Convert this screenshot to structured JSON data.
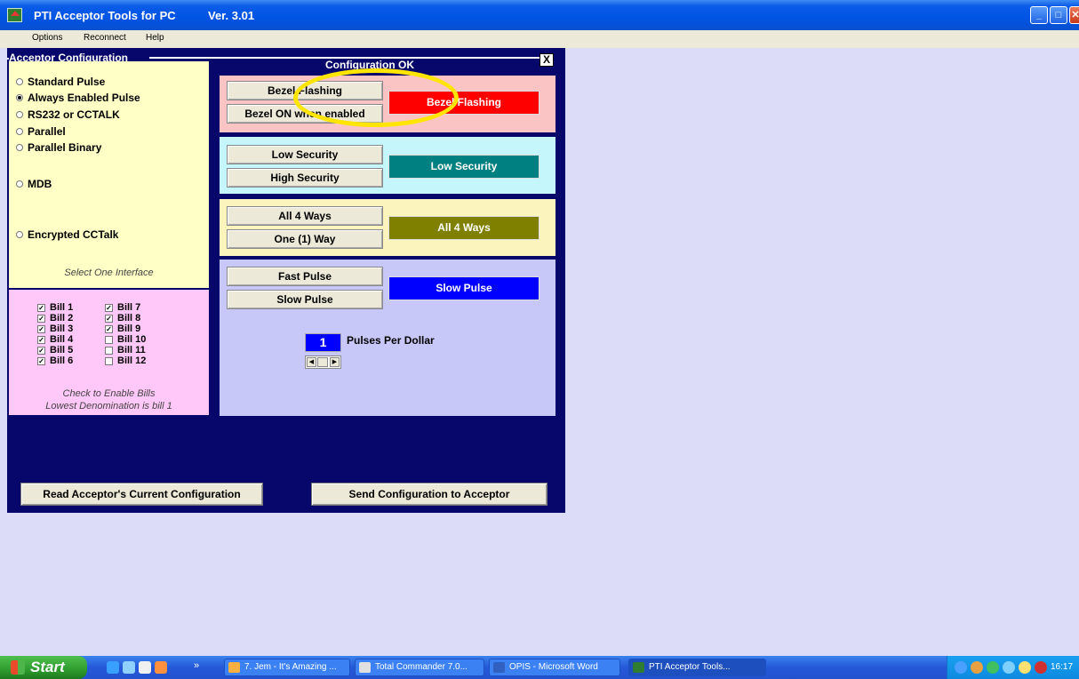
{
  "window": {
    "title": "PTI Acceptor Tools for PC",
    "version": "Ver. 3.01"
  },
  "menu": [
    "Options",
    "Reconnect",
    "Help"
  ],
  "config": {
    "title": "Acceptor Configuration",
    "status": "Configuration OK",
    "close_glyph": "X",
    "interfaces": [
      {
        "label": "Standard Pulse",
        "selected": false
      },
      {
        "label": "Always Enabled Pulse",
        "selected": true
      },
      {
        "label": "RS232 or CCTALK",
        "selected": false
      },
      {
        "label": "Parallel",
        "selected": false
      },
      {
        "label": "Parallel Binary",
        "selected": false
      },
      {
        "label": "MDB",
        "selected": false
      },
      {
        "label": "Encrypted CCTalk",
        "selected": false
      }
    ],
    "interface_hint": "Select One Interface",
    "bills": [
      {
        "label": "Bill 1",
        "checked": true
      },
      {
        "label": "Bill 2",
        "checked": true
      },
      {
        "label": "Bill 3",
        "checked": true
      },
      {
        "label": "Bill 4",
        "checked": true
      },
      {
        "label": "Bill 5",
        "checked": true
      },
      {
        "label": "Bill 6",
        "checked": true
      },
      {
        "label": "Bill 7",
        "checked": true
      },
      {
        "label": "Bill 8",
        "checked": true
      },
      {
        "label": "Bill 9",
        "checked": true
      },
      {
        "label": "Bill 10",
        "checked": false
      },
      {
        "label": "Bill 11",
        "checked": false
      },
      {
        "label": "Bill 12",
        "checked": false
      }
    ],
    "bills_hint1": "Check to Enable Bills",
    "bills_hint2": "Lowest Denomination is bill 1",
    "bezel": {
      "btn1": "Bezel Flashing",
      "btn2": "Bezel ON when enabled",
      "indicator": "Bezel Flashing",
      "indicator_color": "#ff0000"
    },
    "security": {
      "btn1": "Low Security",
      "btn2": "High Security",
      "indicator": "Low Security",
      "indicator_color": "#008080"
    },
    "ways": {
      "btn1": "All 4 Ways",
      "btn2": "One (1) Way",
      "indicator": "All 4 Ways",
      "indicator_color": "#808000"
    },
    "pulse": {
      "btn1": "Fast Pulse",
      "btn2": "Slow Pulse",
      "indicator": "Slow Pulse",
      "indicator_color": "#0000ff",
      "ppd_value": "1",
      "ppd_label": "Pulses Per Dollar"
    },
    "read_button": "Read Acceptor's Current Configuration",
    "send_button": "Send Configuration to Acceptor"
  },
  "taskbar": {
    "start": "Start",
    "chevron": "»",
    "tasks": [
      {
        "label": "7. Jem - It's Amazing ...",
        "active": false
      },
      {
        "label": "Total Commander 7.0...",
        "active": false
      },
      {
        "label": "OPIS - Microsoft Word",
        "active": false
      },
      {
        "label": "PTI Acceptor Tools...",
        "active": true
      }
    ],
    "clock": "16:17"
  },
  "colors": {
    "config_bg": "#07076b",
    "highlight_ring": "#ffe500"
  }
}
